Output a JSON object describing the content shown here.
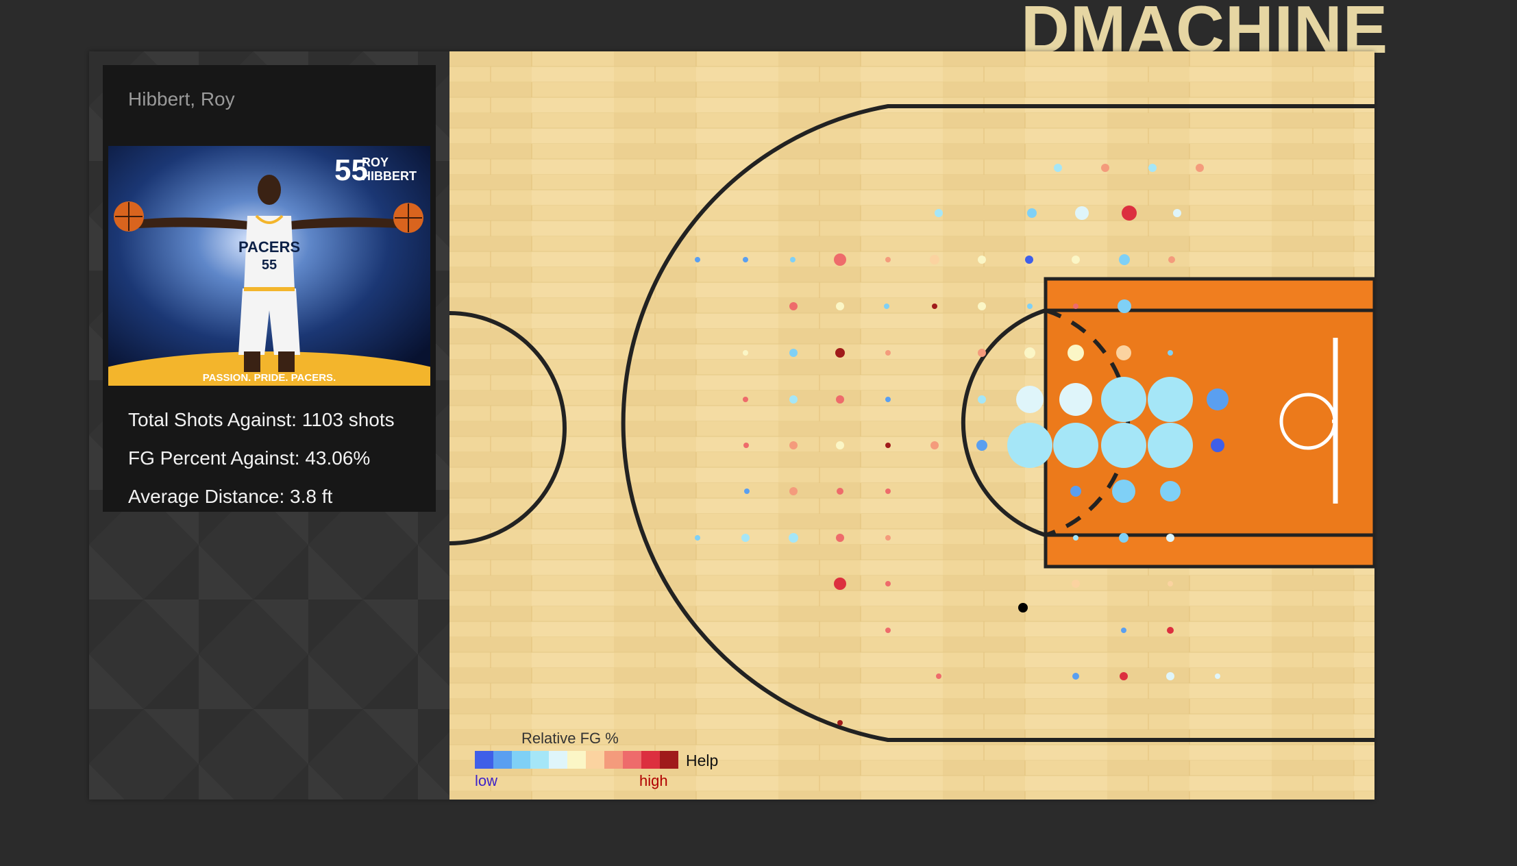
{
  "brand": {
    "logo_text": "DMACHINE"
  },
  "player": {
    "name": "Hibbert, Roy",
    "photo": {
      "jersey_number": "55",
      "first_name": "ROY",
      "last_name": "HIBBERT",
      "team_jersey_text": "PACERS",
      "banner": "PASSION. PRIDE. PACERS."
    }
  },
  "stats": {
    "total_shots": "Total Shots Against: 1103 shots",
    "fg_percent": "FG Percent Against: 43.06%",
    "avg_distance": "Average Distance: 3.8 ft"
  },
  "legend": {
    "title": "Relative FG %",
    "low": "low",
    "high": "high",
    "help": "Help",
    "colors": [
      "#3f5fe8",
      "#5a9ff0",
      "#7fd0f6",
      "#a5e6f7",
      "#dff5fa",
      "#fbf6c6",
      "#fbd3a0",
      "#f49b7c",
      "#ee6b6b",
      "#dc2f3f",
      "#a01b1b"
    ]
  },
  "colors": {
    "court_paint": "#f07e1f",
    "court_wood": "#f1d79a",
    "background": "#2b2b2b"
  }
}
